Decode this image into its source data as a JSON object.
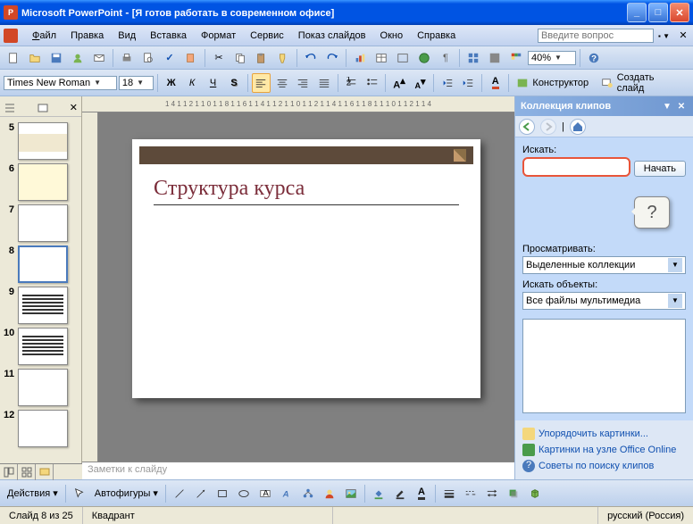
{
  "titlebar": {
    "app": "Microsoft PowerPoint",
    "doc": "[Я готов работать в современном офисе]"
  },
  "menubar": {
    "items": [
      "Файл",
      "Правка",
      "Вид",
      "Вставка",
      "Формат",
      "Сервис",
      "Показ слайдов",
      "Окно",
      "Справка"
    ],
    "help_placeholder": "Введите вопрос"
  },
  "toolbar1": {
    "zoom": "40%"
  },
  "toolbar2": {
    "font": "Times New Roman",
    "size": "18",
    "designer": "Конструктор",
    "new_slide": "Создать слайд"
  },
  "ruler": "1 4 1 1 2 1 1 0 1 1 8 1 1 6 1 1 4 1 1 2 1 1 0 1 1 2 1 1 4 1 1 6 1 1 8 1 1 1 0 1 1 2 1 1 4",
  "thumbs": [
    {
      "n": "5"
    },
    {
      "n": "6"
    },
    {
      "n": "7"
    },
    {
      "n": "8"
    },
    {
      "n": "9"
    },
    {
      "n": "10"
    },
    {
      "n": "11"
    },
    {
      "n": "12"
    }
  ],
  "slide": {
    "title": "Структура курса"
  },
  "notes_placeholder": "Заметки к слайду",
  "taskpane": {
    "title": "Коллекция клипов",
    "search_label": "Искать:",
    "go": "Начать",
    "browse_label": "Просматривать:",
    "browse_value": "Выделенные коллекции",
    "types_label": "Искать объекты:",
    "types_value": "Все файлы мультимедиа",
    "callout": "?",
    "links": {
      "organize": "Упорядочить картинки...",
      "online": "Картинки на узле Office Online",
      "tips": "Советы по поиску клипов"
    }
  },
  "drawbar": {
    "actions": "Действия",
    "autoshapes": "Автофигуры"
  },
  "statusbar": {
    "slide": "Слайд 8 из 25",
    "template": "Квадрант",
    "lang": "русский (Россия)"
  }
}
